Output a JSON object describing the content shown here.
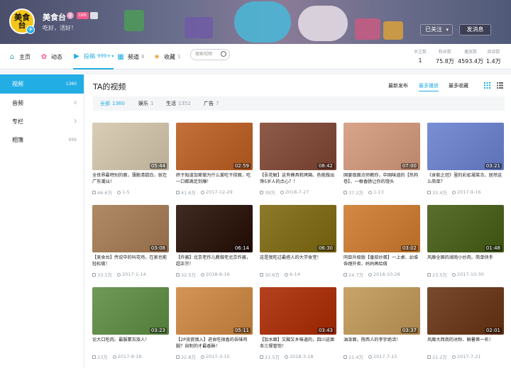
{
  "header": {
    "username": "美食台",
    "avatar_text": "美食台",
    "level": "LV6",
    "signature": "吃好，活好！",
    "follow_btn": "已关注",
    "message_btn": "发消息"
  },
  "nav": {
    "home": "主页",
    "dynamic": "动态",
    "contribute": "投稿",
    "contribute_count": "999+",
    "channel": "频道",
    "channel_count": "8",
    "favorite": "收藏",
    "favorite_count": "1",
    "search_placeholder": "搜索视频"
  },
  "stats": [
    {
      "label": "关注数",
      "value": "1"
    },
    {
      "label": "粉丝数",
      "value": "75.8万"
    },
    {
      "label": "播放数",
      "value": "4593.4万"
    },
    {
      "label": "阅读数",
      "value": "1.4万"
    }
  ],
  "sidebar": [
    {
      "label": "视频",
      "count": "1360"
    },
    {
      "label": "音频",
      "count": "0"
    },
    {
      "label": "专栏",
      "count": "3"
    },
    {
      "label": "相簿",
      "count": "999"
    }
  ],
  "main": {
    "title": "TA的视频",
    "sort_latest": "最新发布",
    "sort_most_played": "最多播放",
    "sort_most_fav": "最多收藏",
    "filters": [
      {
        "label": "全部",
        "count": "1360"
      },
      {
        "label": "娱乐",
        "count": "1"
      },
      {
        "label": "生活",
        "count": "1352"
      },
      {
        "label": "广告",
        "count": "7"
      }
    ]
  },
  "videos": [
    {
      "title": "全世界最特别的面，薄脆清甜白，就在广东潮汕！",
      "duration": "05:44",
      "plays": "46.6万",
      "date": "1-5",
      "color": "#d9cdb6"
    },
    {
      "title": "终于知道加辈做为什么爱吃干捞面，吃一口都满足到爆！",
      "duration": "02:59",
      "plays": "41.6万",
      "date": "2017-12-29",
      "color": "#c4703a"
    },
    {
      "title": "【吾花解】这有模具和烤箱、色能做出馋5岁人的点心？！",
      "duration": "08:42",
      "plays": "39万",
      "date": "2018-7-27",
      "color": "#8e5a4a"
    },
    {
      "title": "国宴级面点师教你，中国味道的【热狗卷】，一根香肠让你的馒头",
      "duration": "07:00",
      "plays": "37.2万",
      "date": "1-13",
      "color": "#d8a48a"
    },
    {
      "title": "《食能之冠》里的彩虹凝菜冻，居然这么简单？",
      "duration": "03:21",
      "plays": "33.4万",
      "date": "2017-9-16",
      "color": "#7a8fd4"
    },
    {
      "title": "【美食台】传说中的叫花鸡，在家也能轻松做！",
      "duration": "03:08",
      "plays": "33.1万",
      "date": "2017-1-14",
      "color": "#b08a66"
    },
    {
      "title": "【炸酱】北京老炸儿教做老北京炸酱，超正宗！",
      "duration": "06:14",
      "plays": "32.5万",
      "date": "2018-6-16",
      "color": "#3f2a22"
    },
    {
      "title": "这是我吃过最搭人的大学食堂！",
      "duration": "06:30",
      "plays": "30.6万",
      "date": "6-14",
      "color": "#8d7a2a"
    },
    {
      "title": "同目升级版【番茄炒蛋】一上桌、幼谁各踏外卖、妈妈再给做",
      "duration": "03:02",
      "plays": "24.7万",
      "date": "2018-10-28",
      "color": "#d48a44"
    },
    {
      "title": "风靡全国的湖南小炒肉、简单快手",
      "duration": "01:48",
      "plays": "23.5万",
      "date": "2017-10-30",
      "color": "#5a6f2e"
    },
    {
      "title": "论大口吃肉、最服蒙古族人！",
      "duration": "03:23",
      "plays": "23万",
      "date": "2017-9-18",
      "color": "#6f9a58"
    },
    {
      "title": "【2P流瓷慎入】进食吃很香的吾味鸡腿？自制的才最香酥！",
      "duration": "05:11",
      "plays": "22.8万",
      "date": "2017-3-15",
      "color": "#d49455"
    },
    {
      "title": "【加水面】又酸又乡味道的，四川这面条三餐管饱！",
      "duration": "03:43",
      "plays": "21.5万",
      "date": "2018-3-18",
      "color": "#b5421f"
    },
    {
      "title": "油泼面，陕西人的李宇绝活！",
      "duration": "03:37",
      "plays": "21.4万",
      "date": "2017-7-15",
      "color": "#c9a46a"
    },
    {
      "title": "风靡大西南的冰粉、解暑第一名！",
      "duration": "02:01",
      "plays": "21.2万",
      "date": "2017-7-21",
      "color": "#7a4a2e"
    }
  ],
  "colors": {
    "accent": "#23ade5",
    "muted": "#99a2aa"
  }
}
